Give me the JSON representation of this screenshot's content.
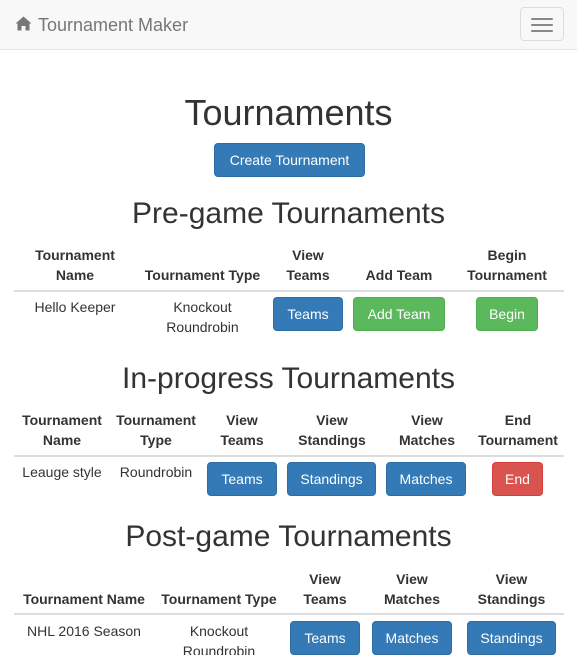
{
  "navbar": {
    "brand": "Tournament Maker"
  },
  "page": {
    "title": "Tournaments",
    "create_button": "Create Tournament"
  },
  "pregame": {
    "title": "Pre-game Tournaments",
    "headers": {
      "name": [
        "Tournament",
        "Name"
      ],
      "type": "Tournament Type",
      "view_teams": [
        "View",
        "Teams"
      ],
      "add_team": "Add Team",
      "begin": [
        "Begin",
        "Tournament"
      ]
    },
    "rows": [
      {
        "name": "Hello Keeper",
        "type": [
          "Knockout",
          "Roundrobin"
        ],
        "teams_button": "Teams",
        "add_team_button": "Add Team",
        "begin_button": "Begin"
      }
    ]
  },
  "inprogress": {
    "title": "In-progress Tournaments",
    "headers": {
      "name": [
        "Tournament",
        "Name"
      ],
      "type": [
        "Tournament",
        "Type"
      ],
      "view_teams": [
        "View",
        "Teams"
      ],
      "view_standings": [
        "View",
        "Standings"
      ],
      "view_matches": [
        "View",
        "Matches"
      ],
      "end": [
        "End",
        "Tournament"
      ]
    },
    "rows": [
      {
        "name": "Leauge style",
        "type": "Roundrobin",
        "teams_button": "Teams",
        "standings_button": "Standings",
        "matches_button": "Matches",
        "end_button": "End"
      }
    ]
  },
  "postgame": {
    "title": "Post-game Tournaments",
    "headers": {
      "name": "Tournament Name",
      "type": "Tournament Type",
      "view_teams": [
        "View",
        "Teams"
      ],
      "view_matches": [
        "View",
        "Matches"
      ],
      "view_standings": [
        "View",
        "Standings"
      ]
    },
    "rows": [
      {
        "name": "NHL 2016 Season",
        "type": [
          "Knockout",
          "Roundrobin"
        ],
        "teams_button": "Teams",
        "matches_button": "Matches",
        "standings_button": "Standings"
      }
    ]
  },
  "colors": {
    "primary": "#337ab7",
    "success": "#5cb85c",
    "danger": "#d9534f",
    "navbar_bg": "#f8f8f8"
  },
  "icons": {
    "brand": "home-icon",
    "menu": "hamburger-menu-icon"
  }
}
